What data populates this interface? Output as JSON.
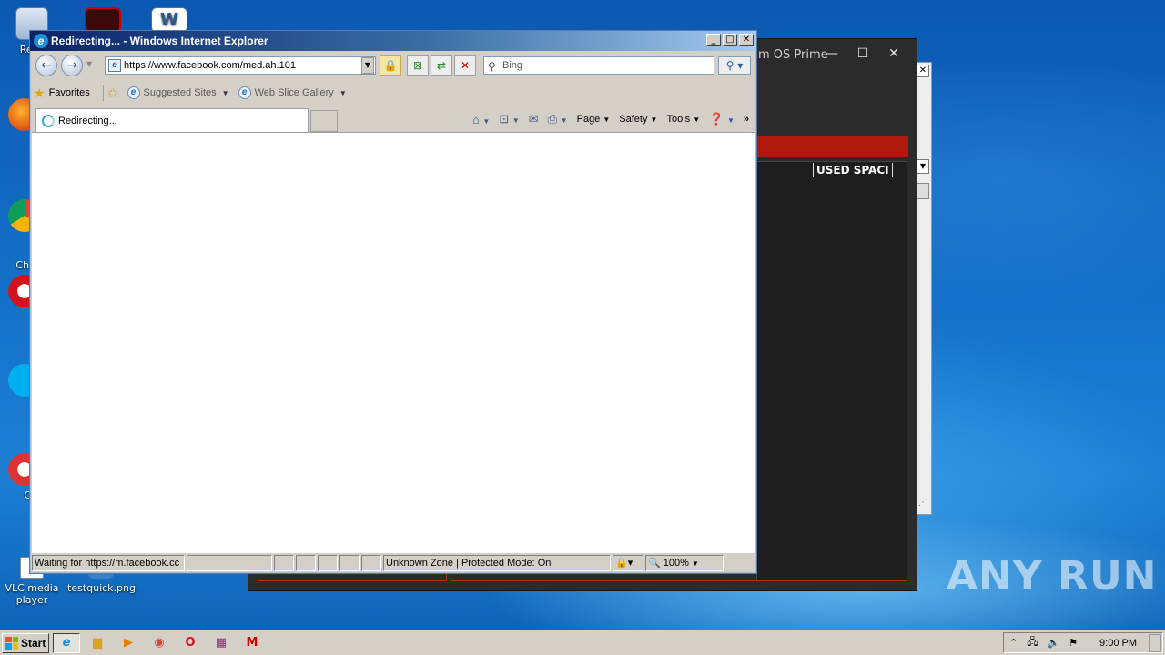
{
  "desktop": {
    "icons": [
      {
        "label": "Recy"
      },
      {
        "label": "Fir"
      },
      {
        "label": "Go\nChr"
      },
      {
        "label": "Op"
      },
      {
        "label": "Sk"
      },
      {
        "label": "CCle"
      },
      {
        "label": "VLC media player"
      },
      {
        "label": "testquick.png"
      }
    ],
    "watermark": "ANY RUN"
  },
  "background_window": {
    "title_fragment": "m OS Prime",
    "column_header": "USED SPACI"
  },
  "ie": {
    "title": "Redirecting... - Windows Internet Explorer",
    "address": "https://www.facebook.com/med.ah.101",
    "search_placeholder": "Bing",
    "favorites_label": "Favorites",
    "suggested_sites": "Suggested Sites",
    "web_slice_gallery": "Web Slice Gallery",
    "tab_title": "Redirecting...",
    "menu": {
      "page": "Page",
      "safety": "Safety",
      "tools": "Tools"
    },
    "status": {
      "message": "Waiting for https://m.facebook.cc",
      "zone": "Unknown Zone | Protected Mode: On",
      "zoom": "100%"
    }
  },
  "taskbar": {
    "start_label": "Start",
    "clock": "9:00 PM"
  }
}
